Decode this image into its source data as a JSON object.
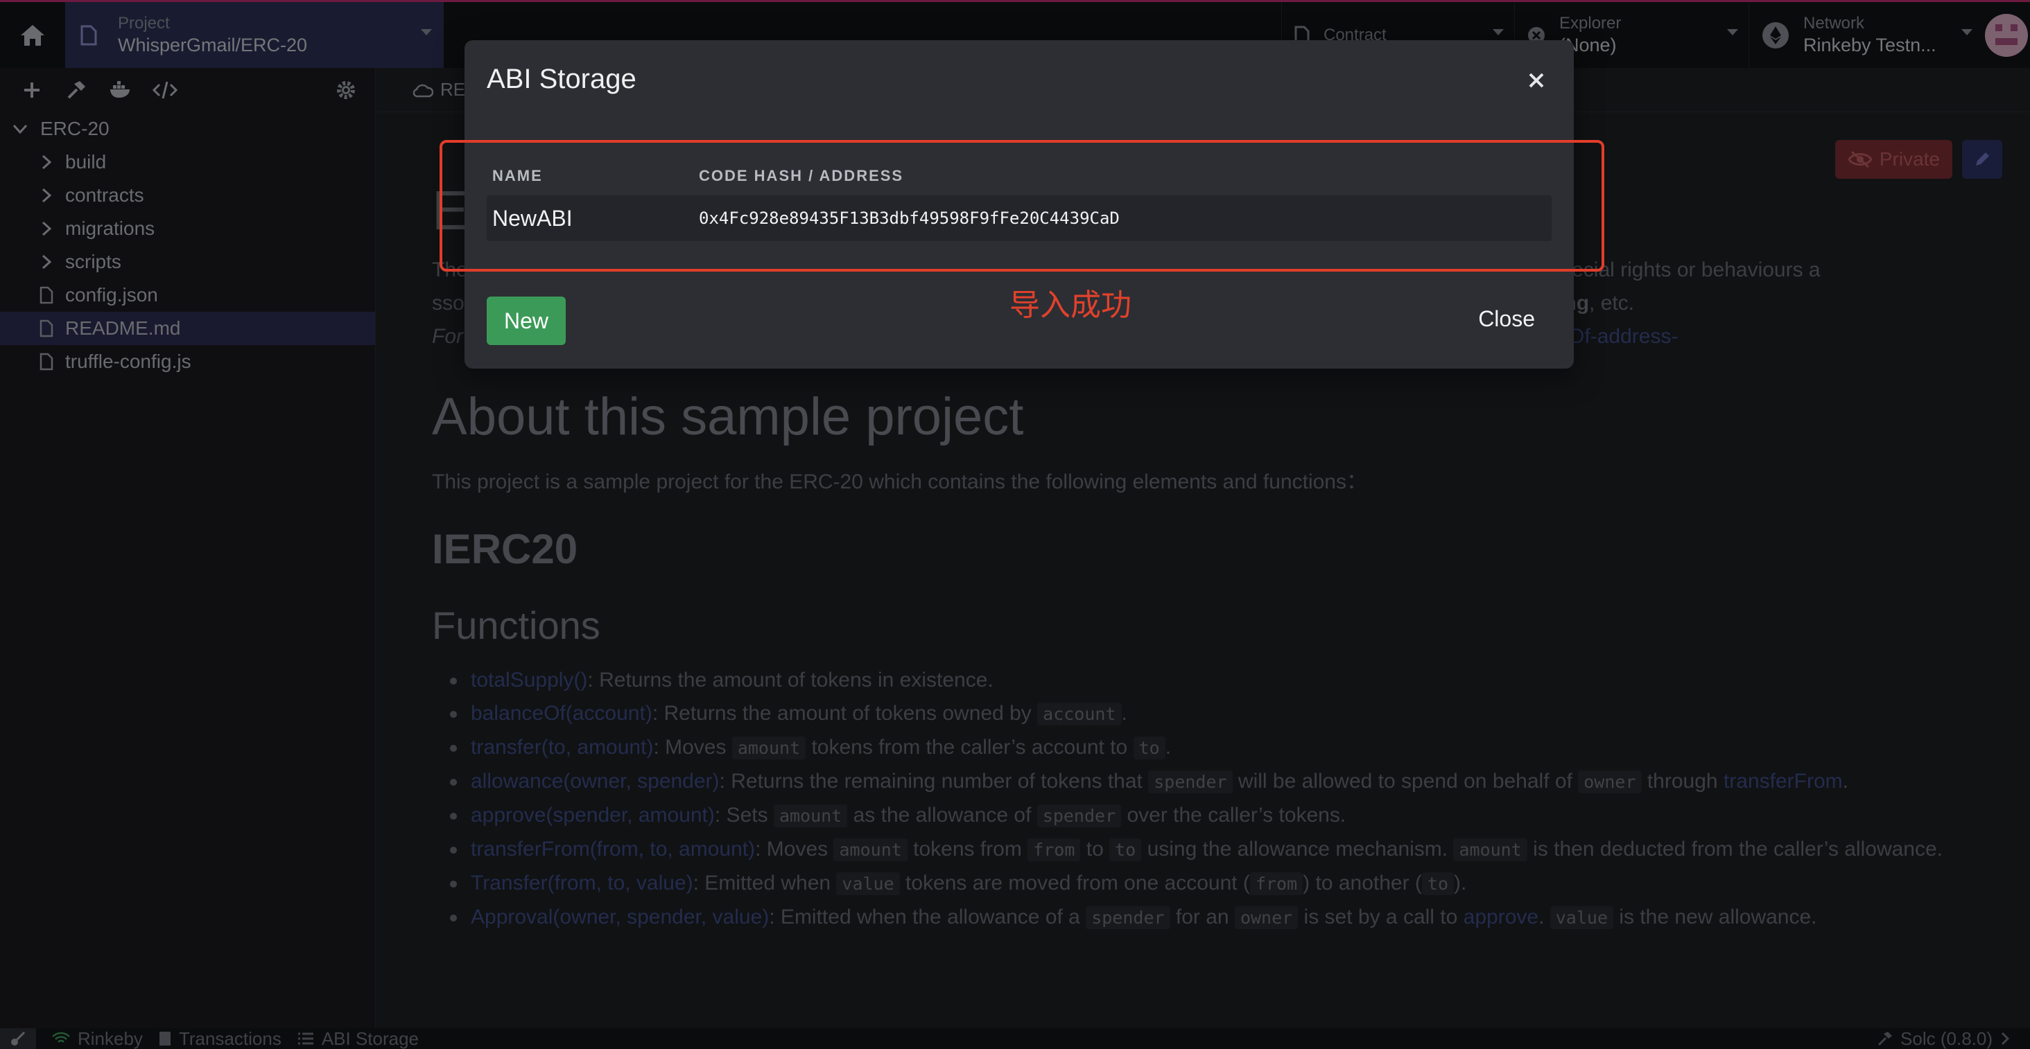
{
  "header": {
    "project_caption": "Project",
    "project_name": "WhisperGmail/ERC-20",
    "contract_caption": "Contract",
    "contract_value": "",
    "explorer_caption": "Explorer",
    "explorer_value": "(None)",
    "network_caption": "Network",
    "network_value": "Rinkeby Testn..."
  },
  "sidebar": {
    "root": "ERC-20",
    "items": [
      {
        "label": "build",
        "type": "folder"
      },
      {
        "label": "contracts",
        "type": "folder"
      },
      {
        "label": "migrations",
        "type": "folder"
      },
      {
        "label": "scripts",
        "type": "folder"
      },
      {
        "label": "config.json",
        "type": "file"
      },
      {
        "label": "README.md",
        "type": "file",
        "selected": true
      },
      {
        "label": "truffle-config.js",
        "type": "file"
      }
    ]
  },
  "tab": {
    "label": "README.md"
  },
  "readme": {
    "private_label": "Private",
    "title_initial": "E",
    "intro_line1_start": "The",
    "intro_line1_end": "en has special rights or behaviours a",
    "intro_line2_start": "sso",
    "intro_line2_bold": "staking",
    "intro_line2_end": ", etc.",
    "intro_line3_start": "For",
    "intro_line3_link": "anceOf-address-",
    "about_heading": "About this sample project",
    "about_text": "This project is a sample project for the ERC-20 which contains the following elements and functions：",
    "ierc_heading": "IERC20",
    "functions_heading": "Functions",
    "functions": [
      {
        "sig": "totalSupply()",
        "parts": [
          ": Returns the amount of tokens in existence."
        ]
      },
      {
        "sig": "balanceOf(account)",
        "parts": [
          ": Returns the amount of tokens owned by ",
          {
            "code": "account"
          },
          "."
        ]
      },
      {
        "sig": "transfer(to, amount)",
        "parts": [
          ": Moves ",
          {
            "code": "amount"
          },
          " tokens from the caller’s account to ",
          {
            "code": "to"
          },
          "."
        ]
      },
      {
        "sig": "allowance(owner, spender)",
        "parts": [
          ": Returns the remaining number of tokens that ",
          {
            "code": "spender"
          },
          " will be allowed to spend on behalf of ",
          {
            "code": "owner"
          },
          " through ",
          {
            "link": "transferFrom"
          },
          "."
        ]
      },
      {
        "sig": "approve(spender, amount)",
        "parts": [
          ": Sets ",
          {
            "code": "amount"
          },
          " as the allowance of ",
          {
            "code": "spender"
          },
          " over the caller’s tokens."
        ]
      },
      {
        "sig": "transferFrom(from, to, amount)",
        "parts": [
          ": Moves ",
          {
            "code": "amount"
          },
          " tokens from ",
          {
            "code": "from"
          },
          " to ",
          {
            "code": "to"
          },
          " using the allowance mechanism. ",
          {
            "code": "amount"
          },
          " is then deducted from the caller’s allowance."
        ]
      },
      {
        "sig": "Transfer(from, to, value)",
        "parts": [
          ": Emitted when ",
          {
            "code": "value"
          },
          " tokens are moved from one account (",
          {
            "code": "from"
          },
          ") to another (",
          {
            "code": "to"
          },
          ")."
        ]
      },
      {
        "sig": "Approval(owner, spender, value)",
        "parts": [
          ": Emitted when the allowance of a ",
          {
            "code": "spender"
          },
          " for an ",
          {
            "code": "owner"
          },
          " is set by a call to ",
          {
            "link": "approve"
          },
          ". ",
          {
            "code": "value"
          },
          " is the new allowance."
        ]
      }
    ]
  },
  "footer": {
    "network": "Rinkeby",
    "transactions": "Transactions",
    "abi_storage": "ABI Storage",
    "compiler": "Solc (0.8.0)"
  },
  "modal": {
    "title": "ABI Storage",
    "col_name": "NAME",
    "col_address": "CODE HASH / ADDRESS",
    "rows": [
      {
        "name": "NewABI",
        "address": "0x4Fc928e89435F13B3dbf49598F9fFe20C4439CaD"
      }
    ],
    "new_label": "New",
    "close_label": "Close"
  },
  "annotation": {
    "text": "导入成功",
    "color": "#e2412b"
  }
}
